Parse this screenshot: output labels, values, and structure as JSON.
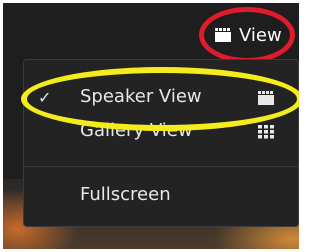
{
  "toolbar": {
    "view_label": "View",
    "view_icon": "speaker-view-icon"
  },
  "menu": {
    "items": [
      {
        "label": "Speaker View",
        "checked": true,
        "icon": "speaker-view-icon"
      },
      {
        "label": "Gallery View",
        "checked": false,
        "icon": "gallery-grid-icon"
      },
      {
        "label": "Fullscreen",
        "checked": false
      }
    ],
    "check_glyph": "✓"
  },
  "annotations": {
    "red_circle_color": "#e01b2b",
    "yellow_circle_color": "#f5ec1c"
  },
  "colors": {
    "menu_background": "#232323",
    "text": "#e8e8e8"
  }
}
